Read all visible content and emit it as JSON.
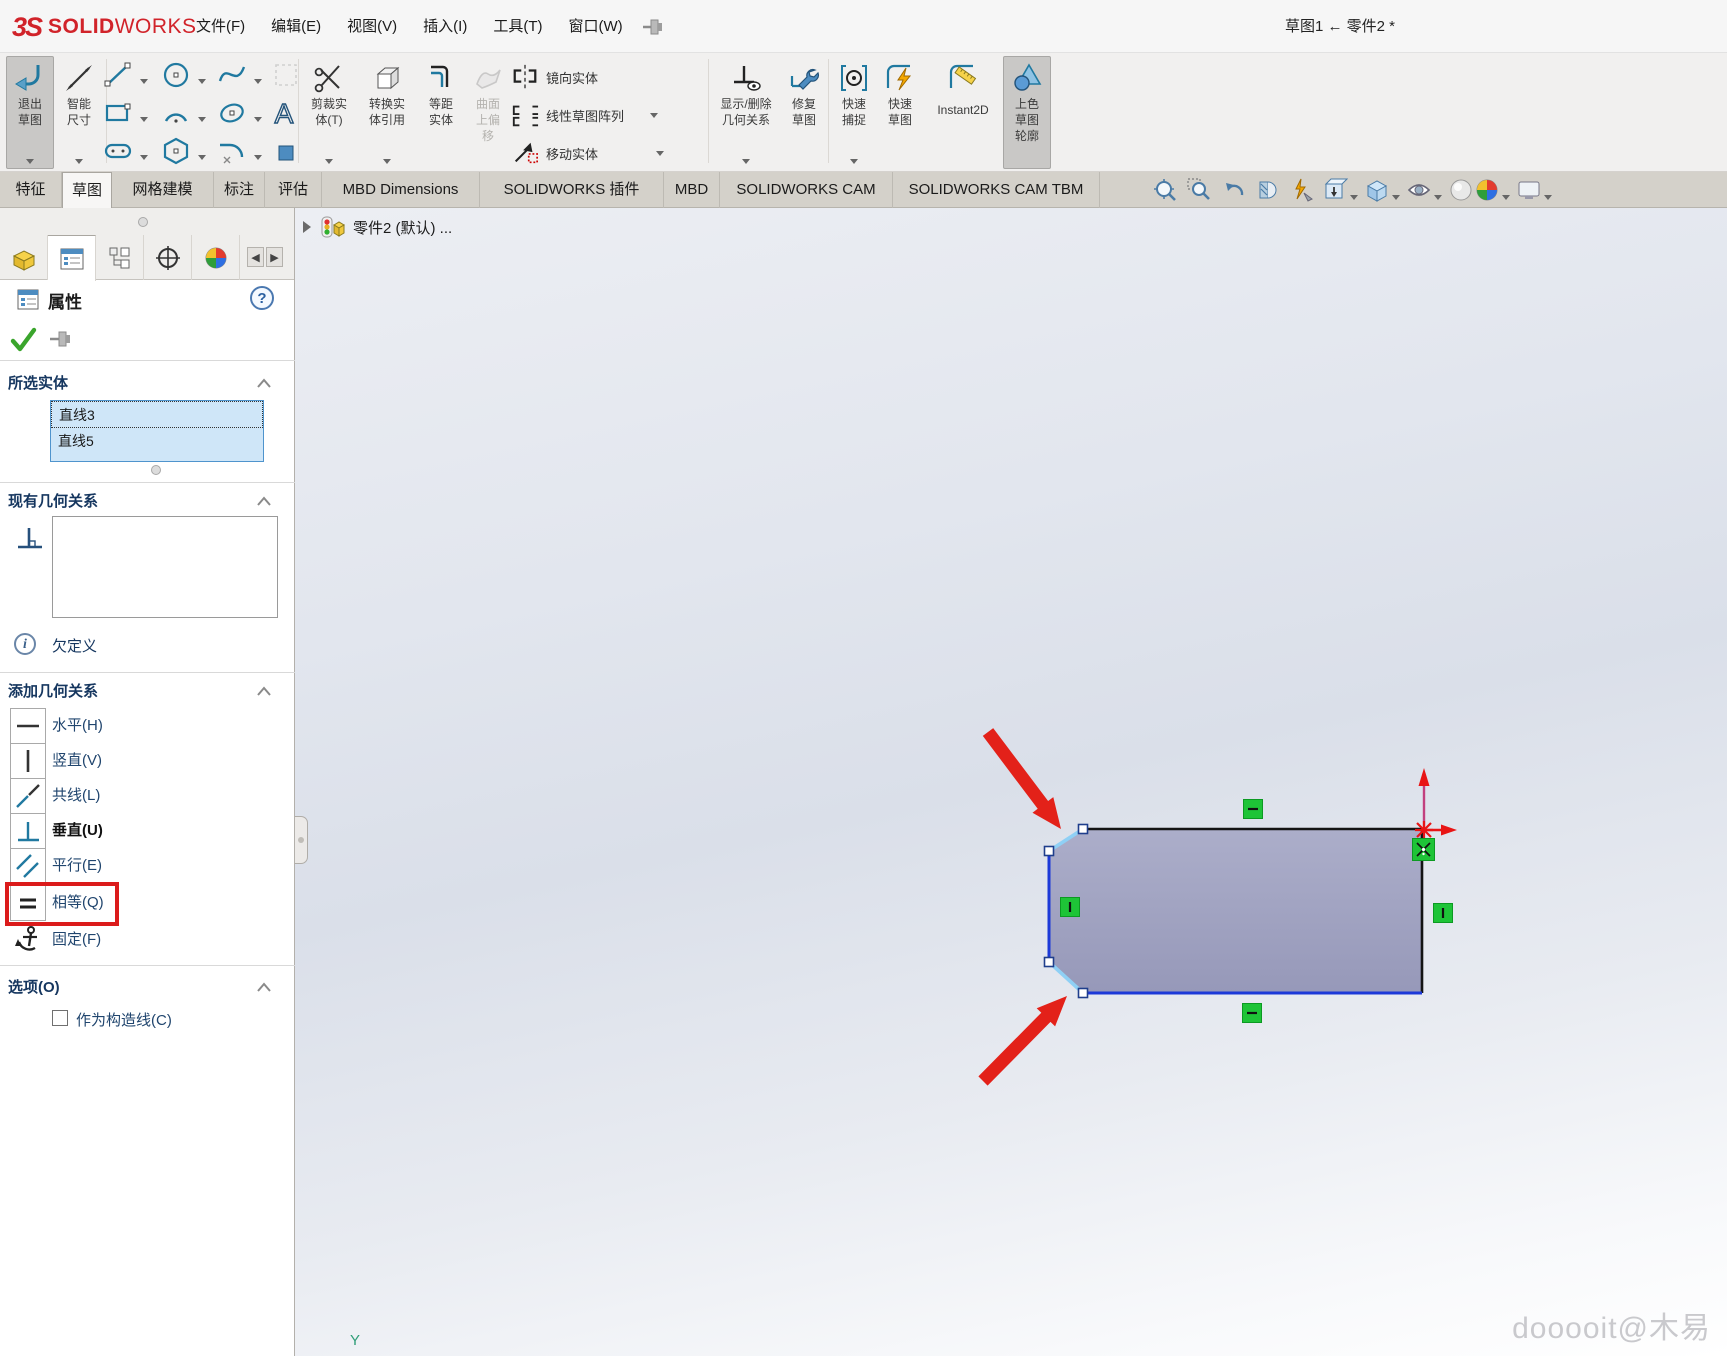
{
  "app": {
    "logo_mark": "3S",
    "logo_text_bold": "SOLID",
    "logo_text_light": "WORKS",
    "doc_title": "草图1 ← 零件2 *"
  },
  "menu": {
    "items": [
      "文件(F)",
      "编辑(E)",
      "视图(V)",
      "插入(I)",
      "工具(T)",
      "窗口(W)"
    ]
  },
  "ribbon": {
    "exit_sketch": {
      "lines": [
        "退出",
        "草图"
      ]
    },
    "smart_dimension": {
      "lines": [
        "智能",
        "尺寸"
      ]
    },
    "trim_entities": {
      "lines": [
        "剪裁实",
        "体(T)"
      ]
    },
    "convert_entities": {
      "lines": [
        "转换实",
        "体引用"
      ]
    },
    "offset_entities": {
      "lines": [
        "等距",
        "实体"
      ]
    },
    "surface_offset": {
      "lines": [
        "曲面",
        "上偏",
        "移"
      ]
    },
    "mirror_entities": {
      "label": "镜向实体"
    },
    "linear_pattern": {
      "label": "线性草图阵列"
    },
    "move_entities": {
      "label": "移动实体"
    },
    "display_delete_relations": {
      "lines": [
        "显示/删除",
        "几何关系"
      ]
    },
    "repair_sketch": {
      "lines": [
        "修复",
        "草图"
      ]
    },
    "quick_snaps": {
      "lines": [
        "快速",
        "捕捉"
      ]
    },
    "rapid_sketch": {
      "lines": [
        "快速",
        "草图"
      ]
    },
    "instant2d": {
      "label": "Instant2D"
    },
    "shaded_contours": {
      "lines": [
        "上色",
        "草图",
        "轮廓"
      ]
    }
  },
  "tabs": {
    "items": [
      {
        "label": "特征"
      },
      {
        "label": "草图",
        "active": true
      },
      {
        "label": "网格建模"
      },
      {
        "label": "标注"
      },
      {
        "label": "评估"
      },
      {
        "label": "MBD Dimensions"
      },
      {
        "label": "SOLIDWORKS 插件"
      },
      {
        "label": "MBD"
      },
      {
        "label": "SOLIDWORKS CAM"
      },
      {
        "label": "SOLIDWORKS CAM TBM"
      }
    ]
  },
  "headsup_icons": [
    "zoom-to-fit",
    "zoom-to-area",
    "previous-view",
    "section-view",
    "dynamic-annotation-views",
    "view-orientation",
    "display-style",
    "hide-show-items",
    "edit-appearance",
    "apply-scene",
    "view-settings"
  ],
  "panel": {
    "title": "属性",
    "tab_icons": [
      "featuremanager-design-tree",
      "propertymanager",
      "configurationmanager",
      "dimxpertmanager",
      "displaymanager"
    ],
    "selected_entities": {
      "title": "所选实体",
      "items": [
        "直线3",
        "直线5"
      ]
    },
    "existing_relations": {
      "title": "现有几何关系",
      "items": []
    },
    "status_text": "欠定义",
    "add_relations": {
      "title": "添加几何关系",
      "items": [
        {
          "label": "水平(H)",
          "icon": "horizontal-relation"
        },
        {
          "label": "竖直(V)",
          "icon": "vertical-relation"
        },
        {
          "label": "共线(L)",
          "icon": "collinear-relation"
        },
        {
          "label": "垂直(U)",
          "icon": "perpendicular-relation",
          "bold": true
        },
        {
          "label": "平行(E)",
          "icon": "parallel-relation"
        },
        {
          "label": "相等(Q)",
          "icon": "equal-relation",
          "highlighted": true
        },
        {
          "label": "固定(F)",
          "icon": "fix-relation"
        }
      ]
    },
    "options": {
      "title": "选项(O)",
      "checkbox_label": "作为构造线(C)",
      "checked": false
    }
  },
  "canvas": {
    "flyout_text": "零件2 (默认) ...",
    "watermark": "dooooit@木易",
    "axis_label": "Y",
    "relation_badges": [
      "horizontal-top",
      "vertical-left",
      "coincident-origin",
      "vertical-right",
      "horizontal-bottom"
    ],
    "selected_edges": [
      "直线3",
      "直线5"
    ]
  },
  "colors": {
    "logo_red": "#d1232a",
    "annotation_red": "#e32119",
    "relation_green": "#1ec437",
    "selection_blue": "#1c39d8",
    "chamfer_highlight": "#8fd0f5",
    "shape_fill": "#9fa1c0",
    "origin_red": "#e81515"
  }
}
